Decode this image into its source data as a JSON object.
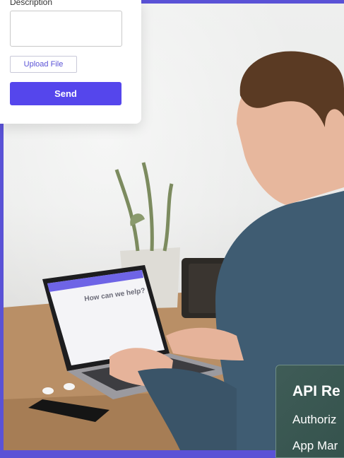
{
  "form": {
    "description_label": "Description",
    "upload_label": "Upload File",
    "send_label": "Send"
  },
  "laptop_screen": {
    "heading": "How can we help?"
  },
  "api_card": {
    "title": "API Re",
    "items": [
      "Authoriz",
      "App Mar"
    ]
  },
  "colors": {
    "accent": "#5546ec",
    "frame": "#5a52d6",
    "api_card_bg": "#3f5c57"
  }
}
